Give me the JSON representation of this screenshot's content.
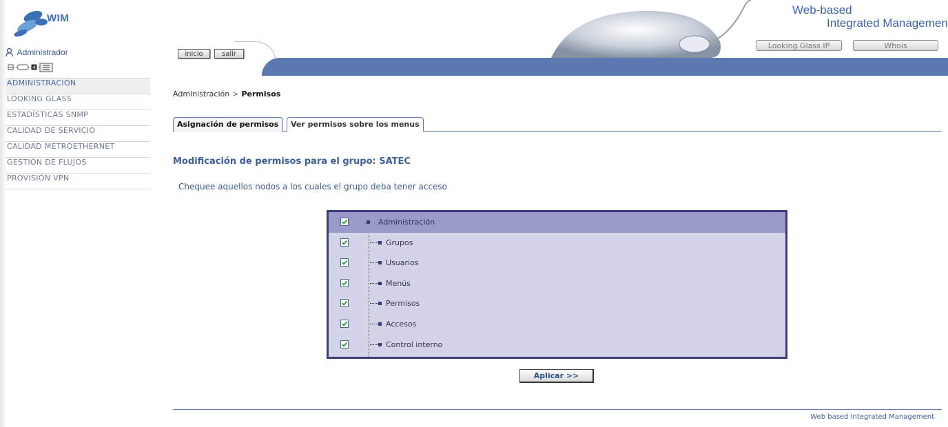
{
  "header": {
    "logo_text": "WIM",
    "brand_line1": "Web-based",
    "brand_line2": "Integrated Management",
    "buttons": [
      "Looking Glass IP",
      "Whois"
    ]
  },
  "nav": {
    "inicio": "inicio",
    "salir": "salir"
  },
  "sidebar": {
    "user": "Administrador",
    "items": [
      "ADMINISTRACIÓN",
      "LOOKING GLASS",
      "ESTADÍSTICAS SNMP",
      "CALIDAD DE SERVICIO",
      "CALIDAD METROETHERNET",
      "GESTIÓN DE FLUJOS",
      "PROVISIÓN VPN"
    ]
  },
  "breadcrumb": {
    "parent": "Administración",
    "separator": ">",
    "current": "Permisos"
  },
  "tabs": [
    "Asignación de permisos",
    "Ver permisos sobre los menus"
  ],
  "section_title": "Modificación de permisos para el grupo: SATEC",
  "instruction": "Chequee aquellos nodos a los cuales el grupo deba tener acceso",
  "permissions": [
    {
      "label": "Administración",
      "checked": true
    },
    {
      "label": "Grupos",
      "checked": true
    },
    {
      "label": "Usuarios",
      "checked": true
    },
    {
      "label": "Menús",
      "checked": true
    },
    {
      "label": "Permisos",
      "checked": true
    },
    {
      "label": "Accesos",
      "checked": true
    },
    {
      "label": "Control interno",
      "checked": true
    }
  ],
  "apply_button": "Aplicar >>",
  "footer": "Web based Integrated Management",
  "colors": {
    "accent": "#5a79b0",
    "box_border": "#3b3b7c",
    "box_bg": "#d4d4e8",
    "root_row": "#9a9ac9",
    "check": "#2e9a2e"
  }
}
